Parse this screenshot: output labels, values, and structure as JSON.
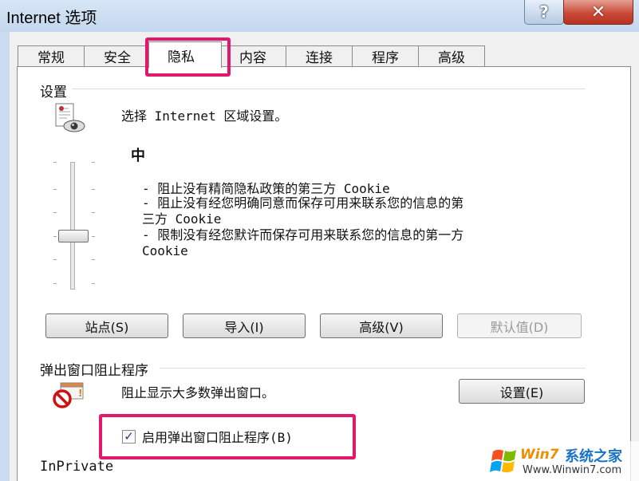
{
  "window": {
    "title": "Internet 选项",
    "help_label": "?",
    "close_label": "✕"
  },
  "tabs": [
    {
      "label": "常规"
    },
    {
      "label": "安全"
    },
    {
      "label": "隐私"
    },
    {
      "label": "内容"
    },
    {
      "label": "连接"
    },
    {
      "label": "程序"
    },
    {
      "label": "高级"
    }
  ],
  "settings": {
    "group_label": "设置",
    "zone_text": "选择 Internet 区域设置。",
    "level": "中",
    "description_lines": [
      "- 阻止没有精简隐私政策的第三方 Cookie",
      "- 阻止没有经您明确同意而保存可用来联系您的信息的第",
      "三方 Cookie",
      "- 限制没有经您默许而保存可用来联系您的信息的第一方",
      "Cookie"
    ],
    "buttons": {
      "sites": "站点(S)",
      "import": "导入(I)",
      "advanced": "高级(V)",
      "default": "默认值(D)"
    }
  },
  "popup": {
    "group_label": "弹出窗口阻止程序",
    "text": "阻止显示大多数弹出窗口。",
    "settings_button": "设置(E)",
    "checkbox_label": "启用弹出窗口阻止程序(B)",
    "checkbox_mark": "✓",
    "checked": true
  },
  "inprivate": {
    "group_label": "InPrivate"
  },
  "watermark": {
    "part1": "Win7",
    "part2": "系统之家",
    "url": "Www.Winwin7.com"
  },
  "colors": {
    "highlight": "#e2186b",
    "titlebar": "#c9dcef",
    "close": "#c94a37"
  }
}
